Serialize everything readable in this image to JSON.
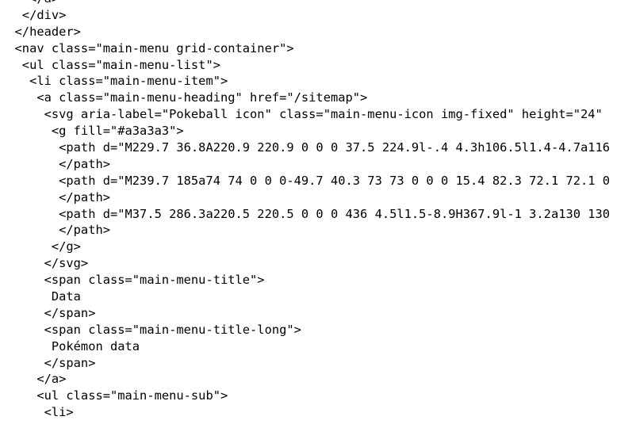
{
  "source": {
    "lines": [
      "    </a>",
      "   </div>",
      "  </header>",
      "  <nav class=\"main-menu grid-container\">",
      "   <ul class=\"main-menu-list\">",
      "    <li class=\"main-menu-item\">",
      "     <a class=\"main-menu-heading\" href=\"/sitemap\">",
      "      <svg aria-label=\"Pokeball icon\" class=\"main-menu-icon img-fixed\" height=\"24\"",
      "       <g fill=\"#a3a3a3\">",
      "        <path d=\"M229.7 36.8A220.9 220.9 0 0 0 37.5 224.9l-.4 4.3h106.5l1.4-4.7a116",
      "        </path>",
      "        <path d=\"M239.7 185a74 74 0 0 0-49.7 40.3 73 73 0 0 0 15.4 82.3 72.1 72.1 0",
      "        </path>",
      "        <path d=\"M37.5 286.3a220.5 220.5 0 0 0 436 4.5l1.5-8.9H367.9l-1 3.2a130 130",
      "        </path>",
      "       </g>",
      "      </svg>",
      "      <span class=\"main-menu-title\">",
      "       Data",
      "      </span>",
      "      <span class=\"main-menu-title-long\">",
      "       Pokémon data",
      "      </span>",
      "     </a>",
      "     <ul class=\"main-menu-sub\">",
      "      <li>"
    ]
  }
}
